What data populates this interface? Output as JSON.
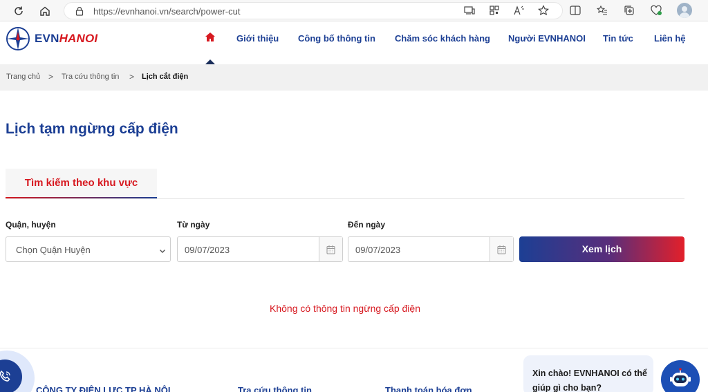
{
  "browser": {
    "url": "https://evnhanoi.vn/search/power-cut"
  },
  "header": {
    "logo_prefix": "EVN",
    "logo_suffix": "HANOI",
    "menu": [
      {
        "label": "Giới thiệu"
      },
      {
        "label": "Công bố thông tin"
      },
      {
        "label": "Chăm sóc khách hàng"
      },
      {
        "label": "Người EVNHANOI"
      },
      {
        "label": "Tin tức"
      },
      {
        "label": "Liên hệ"
      }
    ]
  },
  "breadcrumb": {
    "items": [
      "Trang chủ",
      "Tra cứu thông tin",
      "Lịch cắt điện"
    ],
    "separator": ">"
  },
  "main": {
    "title": "Lịch tạm ngừng cấp điện",
    "tab_label": "Tìm kiếm theo khu vực",
    "district_label": "Quận, huyện",
    "district_value": "Chọn Quận Huyện",
    "from_label": "Từ ngày",
    "from_value": "09/07/2023",
    "to_label": "Đến ngày",
    "to_value": "09/07/2023",
    "submit_label": "Xem lịch",
    "empty_message": "Không có thông tin ngừng cấp điện"
  },
  "footer": {
    "columns": [
      "CÔNG TY ĐIỆN LỰC TP HÀ NỘI",
      "Tra cứu thông tin",
      "Thanh toán hóa đơn"
    ]
  },
  "chat": {
    "greeting": "Xin chào! EVNHANOI có thể giúp gì cho bạn?"
  },
  "colors": {
    "brand_blue": "#1c3f94",
    "brand_red": "#d71920"
  }
}
